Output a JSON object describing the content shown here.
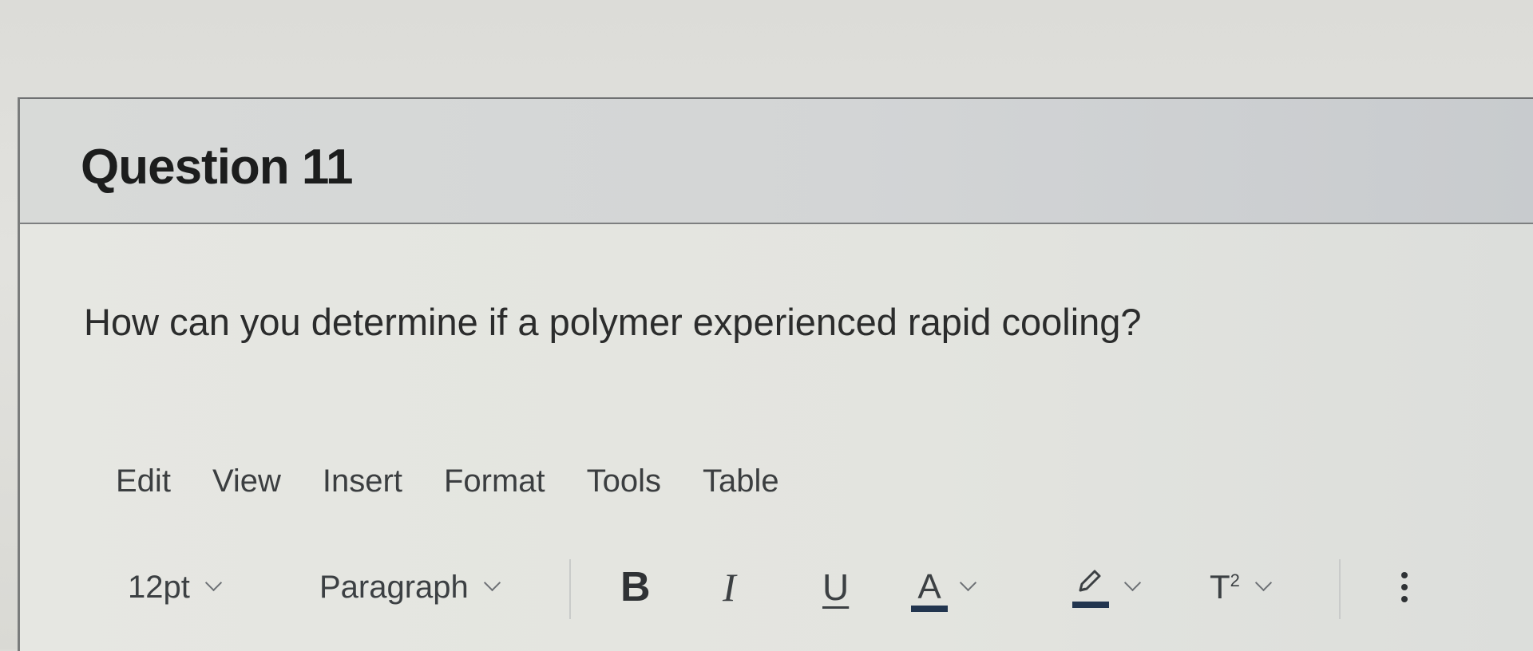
{
  "question": {
    "title": "Question 11",
    "text": "How can you determine if a polymer experienced rapid cooling?"
  },
  "editor": {
    "menu": [
      {
        "label": "Edit"
      },
      {
        "label": "View"
      },
      {
        "label": "Insert"
      },
      {
        "label": "Format"
      },
      {
        "label": "Tools"
      },
      {
        "label": "Table"
      }
    ],
    "toolbar": {
      "font_size": "12pt",
      "block_format": "Paragraph",
      "bold_label": "B",
      "italic_label": "I",
      "underline_label": "U",
      "text_color_label": "A",
      "superscript_label": "T",
      "superscript_exp": "2",
      "text_color": "#22354f",
      "highlight_color": "#22354f"
    }
  }
}
